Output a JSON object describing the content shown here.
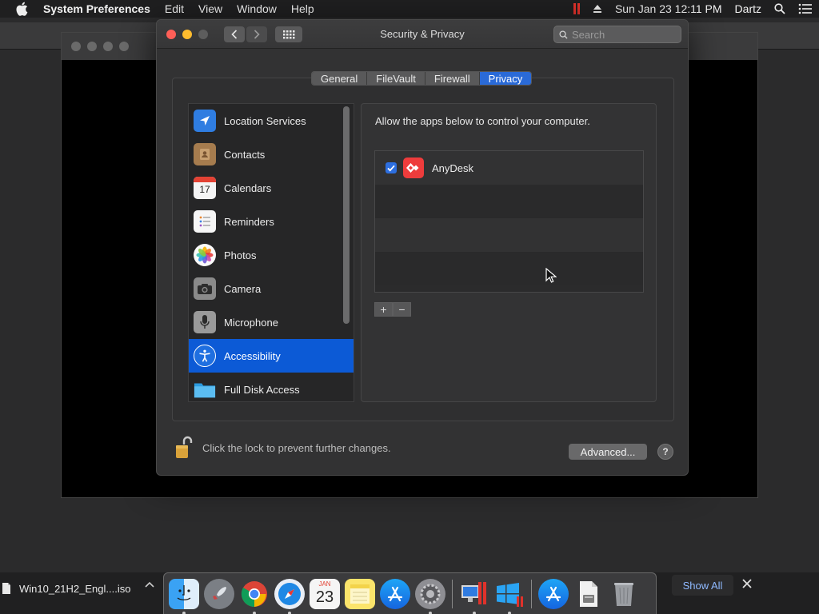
{
  "menubar": {
    "app_name": "System Preferences",
    "items": [
      "Edit",
      "View",
      "Window",
      "Help"
    ],
    "clock": "Sun Jan 23  12:11 PM",
    "user": "Dartz"
  },
  "window": {
    "title": "Security & Privacy",
    "search_placeholder": "Search"
  },
  "tabs": [
    {
      "label": "General"
    },
    {
      "label": "FileVault"
    },
    {
      "label": "Firewall"
    },
    {
      "label": "Privacy",
      "active": true
    }
  ],
  "sidebar": {
    "items": [
      {
        "label": "Location Services",
        "icon": "location-arrow-icon"
      },
      {
        "label": "Contacts",
        "icon": "contacts-book-icon"
      },
      {
        "label": "Calendars",
        "icon": "calendar-icon",
        "icon_text": "17"
      },
      {
        "label": "Reminders",
        "icon": "reminders-list-icon"
      },
      {
        "label": "Photos",
        "icon": "photos-flower-icon"
      },
      {
        "label": "Camera",
        "icon": "camera-icon"
      },
      {
        "label": "Microphone",
        "icon": "microphone-icon"
      },
      {
        "label": "Accessibility",
        "icon": "accessibility-icon",
        "selected": true
      },
      {
        "label": "Full Disk Access",
        "icon": "folder-icon"
      }
    ]
  },
  "privacy": {
    "description": "Allow the apps below to control your computer.",
    "apps": [
      {
        "name": "AnyDesk",
        "checked": true,
        "icon": "anydesk-icon"
      }
    ],
    "add_label": "+",
    "remove_label": "−"
  },
  "footer": {
    "lock_text": "Click the lock to prevent further changes.",
    "advanced_label": "Advanced...",
    "help_label": "?"
  },
  "download_bar": {
    "file_name": "Win10_21H2_Engl....iso",
    "show_all_label": "Show All"
  },
  "dock": {
    "calendar_month": "JAN",
    "calendar_day": "23",
    "apps": [
      "finder-icon",
      "launchpad-icon",
      "chrome-icon",
      "safari-icon",
      "calendar-icon",
      "notes-icon",
      "app-store-icon",
      "system-preferences-icon",
      "parallels-desktop-icon",
      "windows-icon",
      "app-store-downloads-icon",
      "disk-image-icon",
      "trash-icon"
    ]
  },
  "colors": {
    "accent": "#0c5ad6",
    "tab_active": "#2a6ad7",
    "anydesk": "#ee3c3c"
  }
}
